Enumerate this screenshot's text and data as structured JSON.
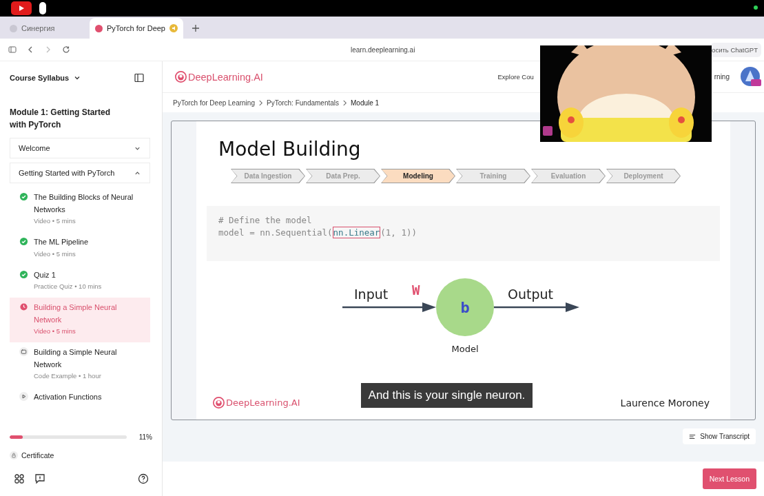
{
  "browser": {
    "tabs": [
      {
        "label": "Синергия",
        "selected": false
      },
      {
        "label": "PyTorch for Deep",
        "selected": true
      }
    ],
    "url": "learn.deeplearning.ai",
    "extension_button": "осить ChatGPT"
  },
  "header": {
    "logo": "DeepLearning.AI",
    "nav": [
      "Explore Cou",
      "rning"
    ]
  },
  "sidebar": {
    "title": "Course Syllabus",
    "module_title": "Module 1: Getting Started with PyTorch",
    "sections": [
      {
        "label": "Welcome",
        "expanded": false
      },
      {
        "label": "Getting Started with PyTorch",
        "expanded": true,
        "items": [
          {
            "title": "The Building Blocks of Neural Networks",
            "meta": "Video • 5 mins",
            "kind": "done",
            "selected": false
          },
          {
            "title": "The ML Pipeline",
            "meta": "Video • 5 mins",
            "kind": "done",
            "selected": false
          },
          {
            "title": "Quiz 1",
            "meta": "Practice Quiz • 10 mins",
            "kind": "done",
            "selected": false
          },
          {
            "title": "Building a Simple Neural Network",
            "meta": "Video • 5 mins",
            "kind": "current",
            "selected": true
          },
          {
            "title": "Building a Simple Neural Network",
            "meta": "Code Example • 1 hour",
            "kind": "code",
            "selected": false
          },
          {
            "title": "Activation Functions",
            "kind": "video",
            "selected": false
          }
        ]
      }
    ],
    "progress": {
      "level": 0.11,
      "label": "11%"
    },
    "certificate": "Certificate"
  },
  "breadcrumbs": [
    "PyTorch for Deep Learning",
    "PyTorch: Fundamentals",
    "Module 1"
  ],
  "slide": {
    "title": "Model Building",
    "steps": [
      {
        "label": "Data Ingestion",
        "selected": false
      },
      {
        "label": "Data Prep.",
        "selected": false
      },
      {
        "label": "Modeling",
        "selected": true
      },
      {
        "label": "Training",
        "selected": false
      },
      {
        "label": "Evaluation",
        "selected": false
      },
      {
        "label": "Deployment",
        "selected": false
      }
    ],
    "code": {
      "comment": "# Define the model",
      "before": "model = nn.Sequential(",
      "highlighted": "nn.Linear",
      "after": "(1, 1))"
    },
    "diagram": {
      "input": "Input",
      "weight": "W",
      "bias": "b",
      "output": "Output",
      "node_label": "Model"
    },
    "logo": "DeepLearning.AI",
    "presenter": "Laurence Moroney",
    "caption": "And this is your single neuron."
  },
  "transcript_button": "Show Transcript",
  "next_button": "Next Lesson"
}
